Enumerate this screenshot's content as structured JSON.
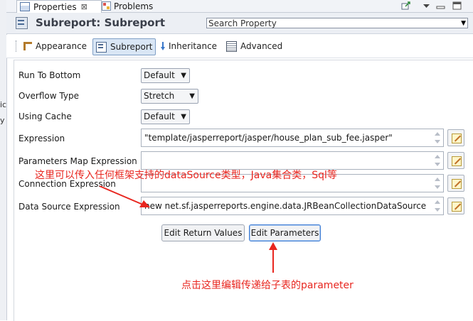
{
  "left_strip": {
    "fragments": [
      "ic",
      "y"
    ]
  },
  "tabs": [
    {
      "label": "Properties",
      "close": "⊠",
      "icon": "properties-view-icon"
    },
    {
      "label": "Problems",
      "icon": "problems-view-icon"
    }
  ],
  "header": {
    "title": "Subreport: Subreport",
    "icon": "subreport-icon"
  },
  "search": {
    "placeholder": "Search Property",
    "arrow": "▼"
  },
  "sections": [
    {
      "label": "Appearance",
      "icon": "appearance-icon"
    },
    {
      "label": "Subreport",
      "icon": "subreport-section-icon",
      "active": true
    },
    {
      "label": "Inheritance",
      "icon": "inheritance-icon"
    },
    {
      "label": "Advanced",
      "icon": "advanced-icon"
    }
  ],
  "properties": {
    "run_to_bottom": {
      "label": "Run To Bottom",
      "value": "Default",
      "arrow": "▼"
    },
    "overflow_type": {
      "label": "Overflow Type",
      "value": "Stretch",
      "arrow": "▼"
    },
    "using_cache": {
      "label": "Using Cache",
      "value": "Default",
      "arrow": "▼"
    },
    "expression": {
      "label": "Expression",
      "value": "\"template/jasperreport/jasper/house_plan_sub_fee.jasper\""
    },
    "parameters_map": {
      "label": "Parameters Map Expression",
      "value": ""
    },
    "connection": {
      "label": "Connection Expression",
      "value": ""
    },
    "data_source": {
      "label": "Data Source Expression",
      "value": "new net.sf.jasperreports.engine.data.JRBeanCollectionDataSource"
    }
  },
  "buttons": {
    "edit_return_values": "Edit Return Values",
    "edit_parameters": "Edit Parameters"
  },
  "annotations": {
    "top": "这里可以传入任何框架支持的dataSource类型，Java集合类，Sql等",
    "bottom": "点击这里编辑传递给子表的parameter",
    "color": "#e8261f"
  }
}
